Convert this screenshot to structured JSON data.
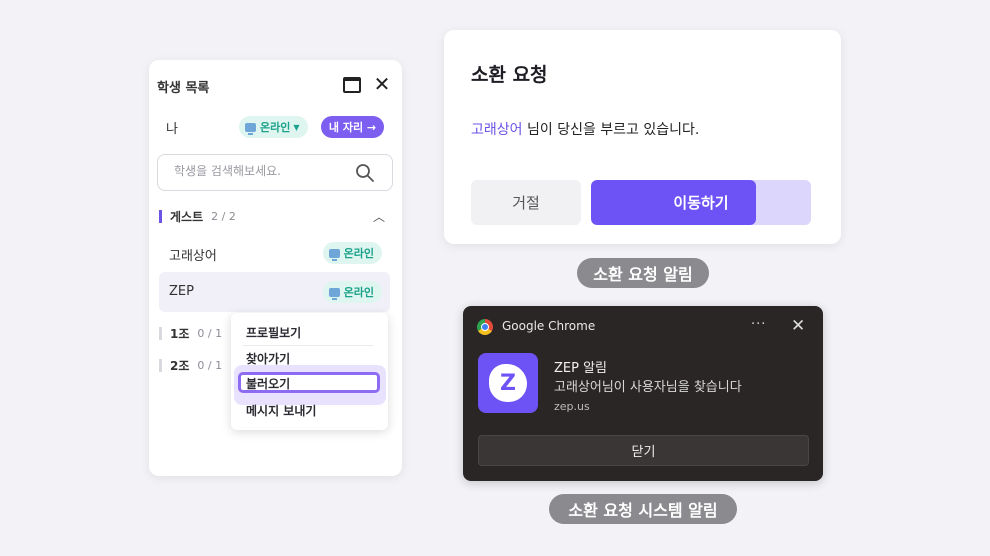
{
  "student_panel": {
    "title": "학생 목록",
    "me_label": "나",
    "my_status": "온라인",
    "my_seat_button": "내 자리 →",
    "search_placeholder": "학생을 검색해보세요.",
    "groups": [
      {
        "name": "게스트",
        "count": "2 / 2"
      },
      {
        "name": "1조",
        "count": "0 / 1"
      },
      {
        "name": "2조",
        "count": "0 / 1"
      }
    ],
    "students": [
      {
        "name": "고래상어",
        "status": "온라인"
      },
      {
        "name": "ZEP",
        "status": "온라인"
      }
    ],
    "context_menu": [
      "프로필보기",
      "찾아가기",
      "불러오기",
      "메시지 보내기"
    ]
  },
  "summon_dialog": {
    "title": "소환 요청",
    "requester": "고래상어",
    "message": " 님이 당신을 부르고 있습니다.",
    "decline_label": "거절",
    "move_label": "이동하기",
    "move_progress": 0.75,
    "caption": "소환 요청 알림"
  },
  "system_notification": {
    "app_name": "Google Chrome",
    "more_glyph": "···",
    "close_glyph": "✕",
    "title": "ZEP 알림",
    "body": "고래상어님이 사용자님을 찾습니다",
    "site": "zep.us",
    "dismiss_label": "닫기",
    "caption": "소환 요청 시스템 알림"
  },
  "colors": {
    "accent": "#6d52f5",
    "online_text": "#1ca28a",
    "online_bg": "#def5f0",
    "notification_bg": "#2a2625"
  }
}
